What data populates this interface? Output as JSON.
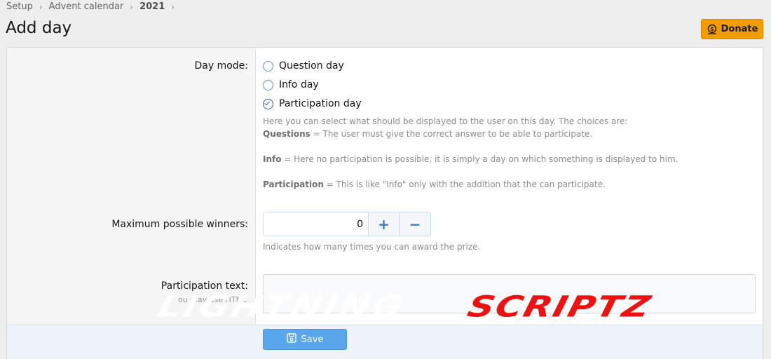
{
  "breadcrumb": {
    "items": [
      "Setup",
      "Advent calendar",
      "2021"
    ]
  },
  "page_title": "Add day",
  "donate_button": {
    "label": "Donate",
    "icon": "dollar-badge-icon"
  },
  "form": {
    "day_mode": {
      "label": "Day mode:",
      "options": [
        {
          "label": "Question day",
          "checked": false
        },
        {
          "label": "Info day",
          "checked": false
        },
        {
          "label": "Participation day",
          "checked": true
        }
      ],
      "explain_intro": "Here you can select what should be displayed to the user on this day. The choices are:",
      "explain_questions_term": "Questions",
      "explain_questions_text": " = The user must give the correct answer to be able to participate.",
      "explain_info_term": "Info",
      "explain_info_text": " = Here no participation is possible, it is simply a day on which something is displayed to him.",
      "explain_participation_term": "Participation",
      "explain_participation_text": " = This is like \"Info\" only with the addition that the can participate."
    },
    "max_winners": {
      "label": "Maximum possible winners:",
      "value": "0",
      "plus": "+",
      "minus": "−",
      "hint": "Indicates how many times you can award the prize."
    },
    "participation_text": {
      "label": "Participation text:",
      "value": "",
      "hint": "ou may use HTML"
    }
  },
  "save_button": {
    "label": "Save",
    "icon": "floppy-disk-icon"
  },
  "watermark": {
    "light": "LIGHTNING",
    "red": "SCRIPTZ"
  },
  "colors": {
    "accent": "#5aa6ec",
    "donate": "#f19d00",
    "watermark_red": "#ee1111"
  }
}
